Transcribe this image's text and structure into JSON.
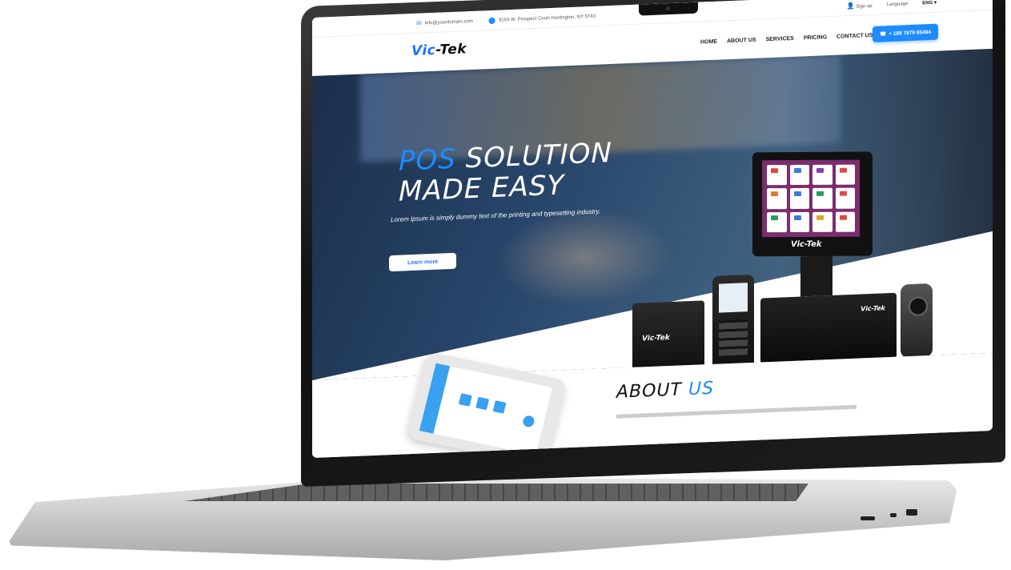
{
  "topbar": {
    "email": "info@yourdomain.com",
    "address": "9163 W. Prospect Court Huntington, NY 5743",
    "signup": "Sign up",
    "language_label": "Language",
    "language_value": "ENG"
  },
  "nav": {
    "logo_prefix": "Vic",
    "logo_suffix": "-Tek",
    "items": [
      "HOME",
      "ABOUT US",
      "SERVICES",
      "PRICING",
      "CONTACT US"
    ],
    "phone": "+ 188 7879 65484"
  },
  "hero": {
    "title_accent": "POS",
    "title_rest": "SOLUTION",
    "title_line2": "MADE EASY",
    "subtitle": "Lorem Ipsum is simply dummy text of the printing and typesetting industry.",
    "cta": "Learn more",
    "device_brand": "Vic-Tek"
  },
  "about": {
    "title_main": "ABOUT",
    "title_accent": "US"
  },
  "colors": {
    "accent": "#1e8bff",
    "hero_dark": "#1a2f4a"
  }
}
